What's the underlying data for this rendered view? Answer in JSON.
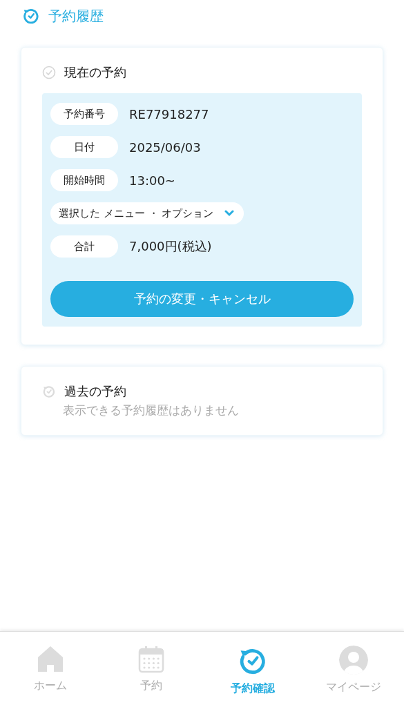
{
  "header": {
    "title": "予約履歴"
  },
  "current": {
    "title": "現在の予約",
    "rows": [
      {
        "kind": "field",
        "label": "予約番号",
        "value": "RE77918277"
      },
      {
        "kind": "field",
        "label": "日付",
        "value": "2025/06/03"
      },
      {
        "kind": "field",
        "label": "開始時間",
        "value": "13:00~"
      },
      {
        "kind": "dropdown",
        "label": "選択した メニュー ・ オプション",
        "expanded": false
      },
      {
        "kind": "field",
        "label": "合計",
        "value": "7,000円(税込)"
      }
    ],
    "button": "予約の変更・キャンセル"
  },
  "past": {
    "title": "過去の予約",
    "empty_message": "表示できる予約履歴はありません"
  },
  "tab_bar": [
    {
      "kind": "home",
      "label": "ホーム",
      "selected": false
    },
    {
      "kind": "calendar",
      "label": "予約",
      "selected": false
    },
    {
      "kind": "history",
      "label": "予約確認",
      "selected": true
    },
    {
      "kind": "user",
      "label": "マイページ",
      "selected": false
    }
  ]
}
